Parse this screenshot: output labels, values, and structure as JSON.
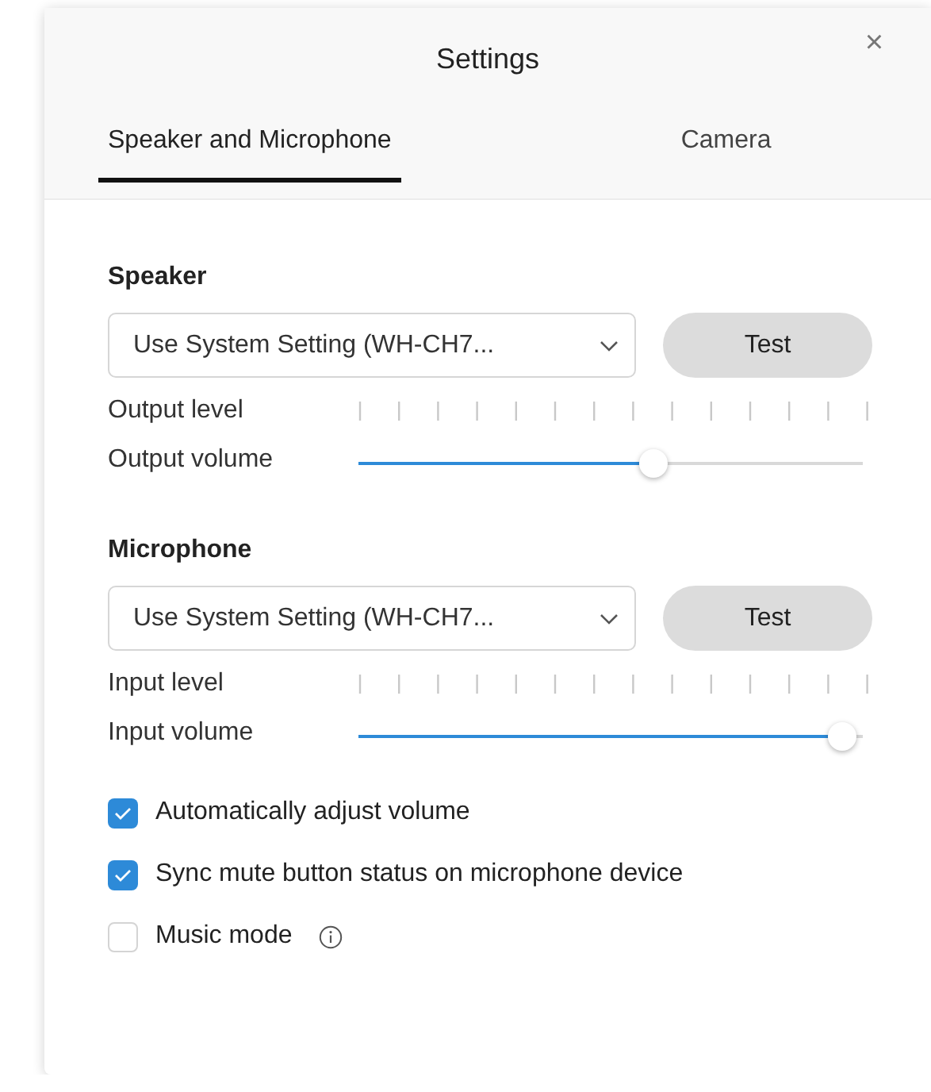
{
  "window": {
    "title": "Settings",
    "close": "×"
  },
  "tabs": [
    {
      "label": "Speaker and Microphone",
      "selected": true
    },
    {
      "label": "Camera",
      "selected": false
    }
  ],
  "sections": [
    {
      "heading": "Speaker",
      "device": "Use System Setting (WH-CH7...",
      "test_button": "Test",
      "level_label": "Output level",
      "volume_label": "Output volume",
      "volume": {
        "level": 0.59
      }
    },
    {
      "heading": "Microphone",
      "device": "Use System Setting (WH-CH7...",
      "test_button": "Test",
      "level_label": "Input level",
      "volume_label": "Input volume",
      "volume": {
        "level": 0.985
      }
    }
  ],
  "options": [
    {
      "label": "Automatically adjust volume",
      "checked": true,
      "info": false
    },
    {
      "label": "Sync mute button status on microphone device",
      "checked": true,
      "info": false
    },
    {
      "label": "Music mode",
      "checked": false,
      "info": true
    }
  ]
}
